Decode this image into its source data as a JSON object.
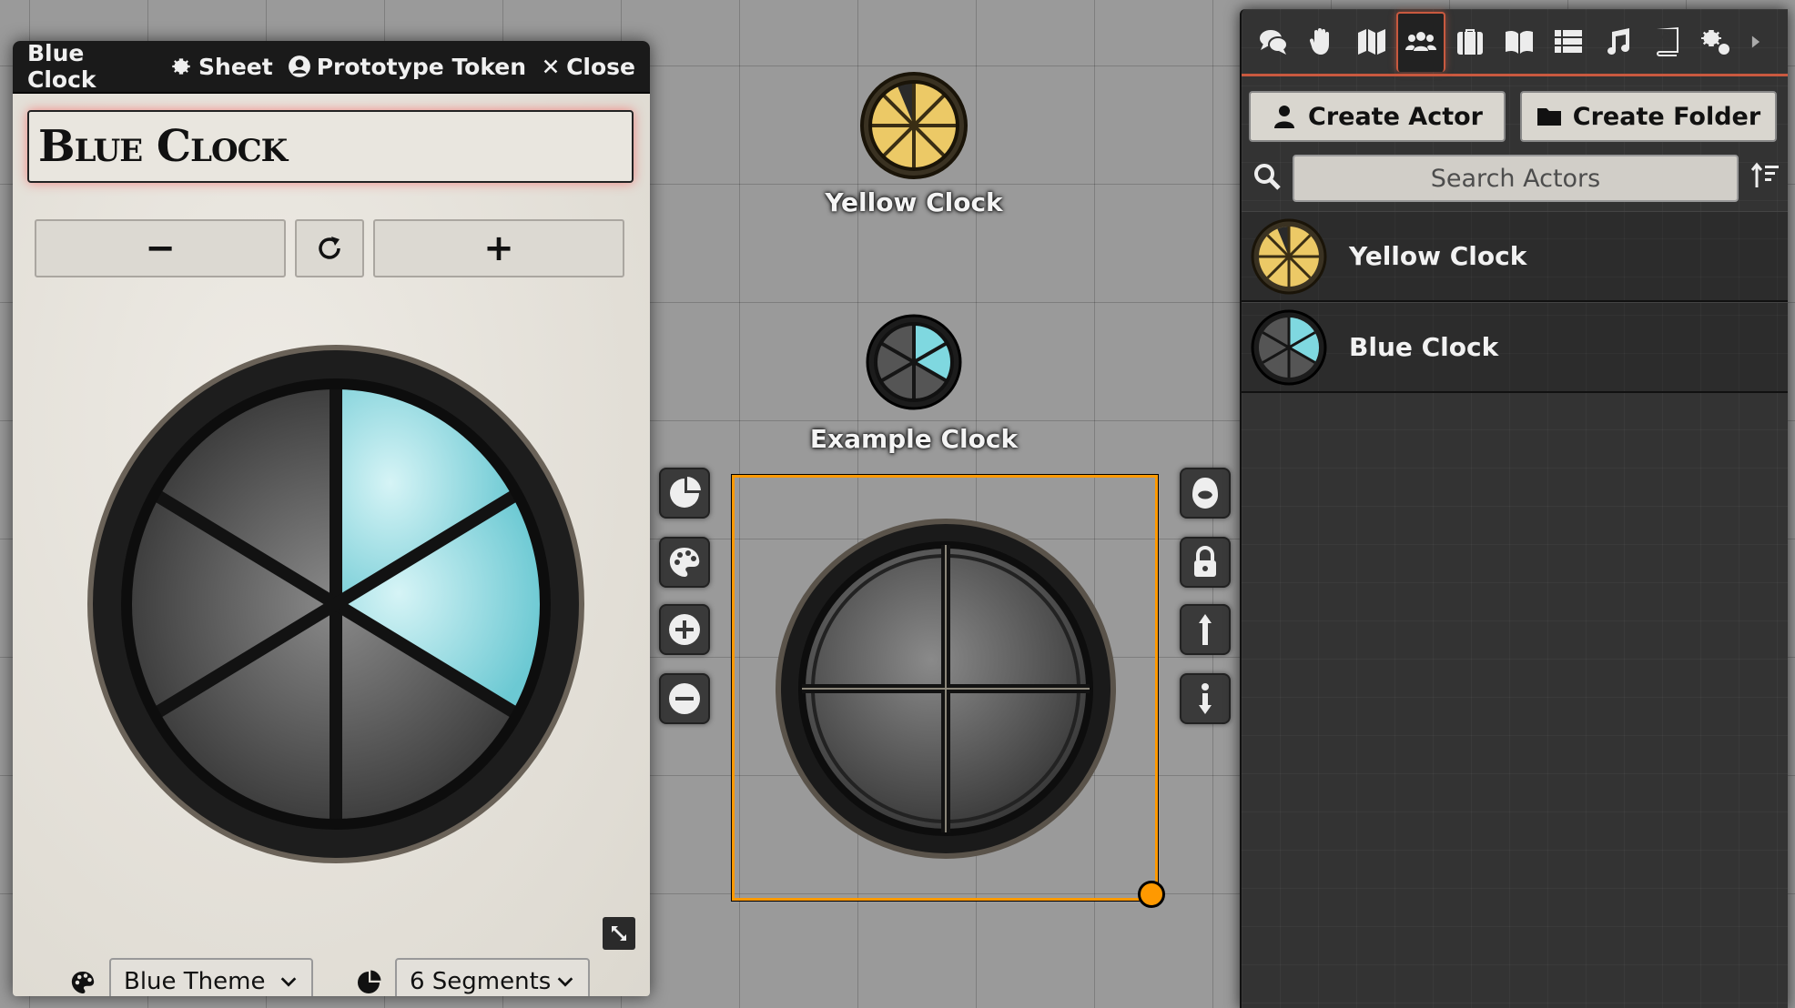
{
  "sheet": {
    "title": "Blue Clock",
    "header_buttons": {
      "sheet": "Sheet",
      "prototype": "Prototype Token",
      "close": "Close"
    },
    "name_value": "Blue Clock",
    "controls": {
      "decrement": "−",
      "increment": "+"
    },
    "theme_select": {
      "value": "Blue Theme"
    },
    "segments_select": {
      "value": "6 Segments"
    },
    "clock": {
      "segments": 6,
      "filled": 2,
      "fill_color": "#7fd8e0",
      "color": "#4a4a4a"
    }
  },
  "canvas": {
    "tokens": [
      {
        "label": "Yellow Clock",
        "color": "#e8c560",
        "segments": 8,
        "filled": 7
      },
      {
        "label": "Example Clock",
        "color": "#6fd0db",
        "segments": 6,
        "filled": 2
      }
    ],
    "selected_clock": {
      "segments": 4,
      "filled": 0
    },
    "selection_color": "#ff9900"
  },
  "sidebar": {
    "tabs": [
      "chat-icon",
      "combat-icon",
      "scenes-icon",
      "actors-icon",
      "items-icon",
      "journal-icon",
      "tables-icon",
      "playlists-icon",
      "compendium-icon",
      "settings-icon",
      "collapse-icon"
    ],
    "active_tab": 3,
    "create_actor": "Create Actor",
    "create_folder": "Create Folder",
    "search_placeholder": "Search Actors",
    "actors": [
      {
        "name": "Yellow Clock"
      },
      {
        "name": "Blue Clock"
      }
    ],
    "accent_color": "#c9593f"
  }
}
